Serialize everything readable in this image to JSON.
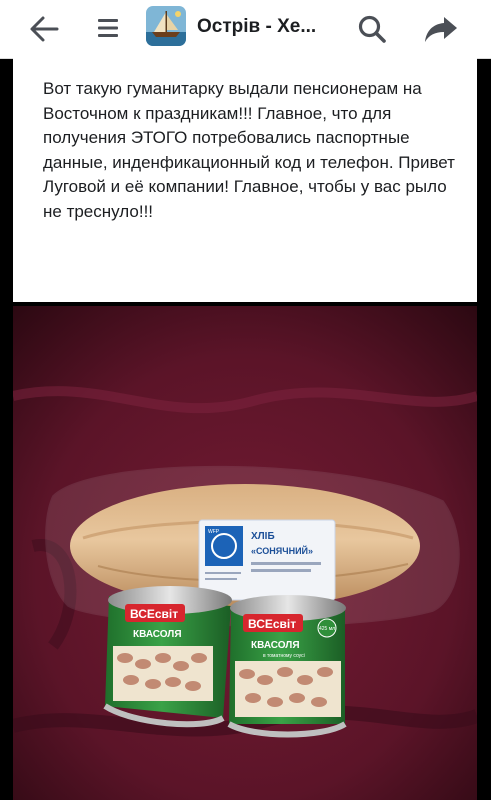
{
  "topbar": {
    "title": "Острів - Хе...",
    "icons": [
      "back-arrow-icon",
      "menu-icon",
      "group-avatar",
      "search-icon",
      "share-icon"
    ]
  },
  "post": {
    "text": "Вот такую гуманитарку выдали пенсионерам на Восточном к праздникам!!! Главное, что для получения ЭТОГО потребовались паспортные данные, инденфикационный код и телефон. Привет Луговой и её компании! Главное, чтобы у вас рыло не треснуло!!!"
  },
  "photo": {
    "bread_label": {
      "line1": "ХЛІБ",
      "line2": "«СОНЯЧНИЙ»",
      "org": "WFP"
    },
    "can_brand": "ВСЕсвіт",
    "can_product": "КВАСОЛЯ",
    "can_subtext": "в томатному соусі",
    "can_weight": "425 мл"
  },
  "colors": {
    "topbar_bg": "#ffffff",
    "text": "#1c1e21",
    "icon": "#4b4f56",
    "cloth": "#5b1428",
    "can_green": "#2f8f3a",
    "can_red": "#d7262e"
  }
}
